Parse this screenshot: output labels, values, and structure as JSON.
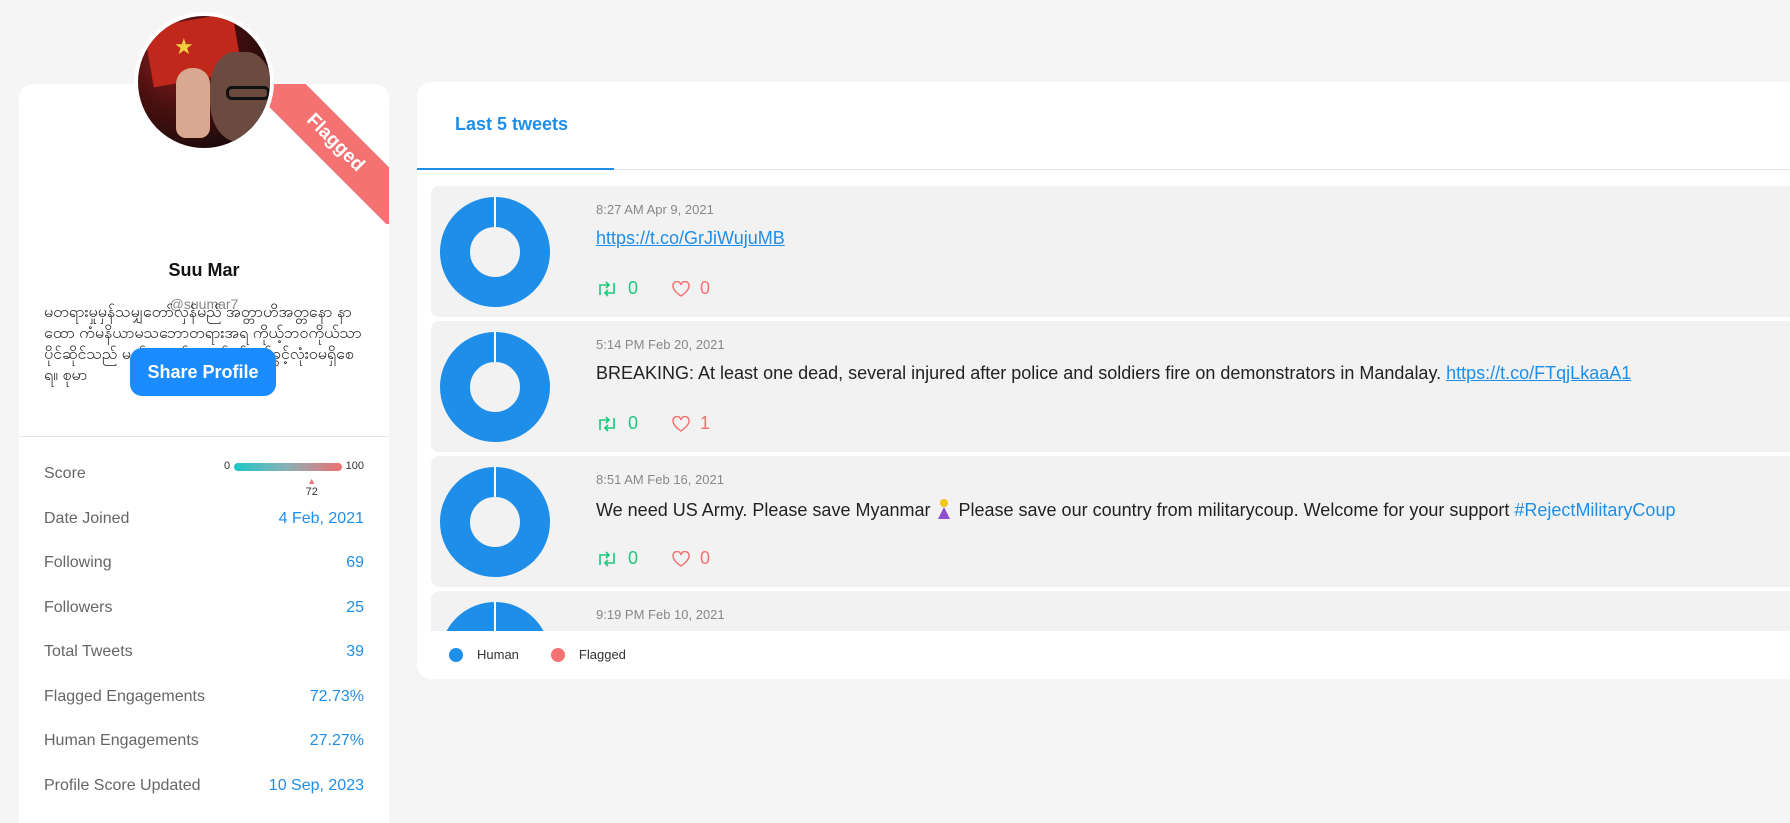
{
  "profile": {
    "name": "Suu Mar",
    "handle": "@suumar7",
    "bio": "မတရားမှုမှန်သမျှတော်လှန်မည် အတ္တာဟိအတ္တနော နာထော ကံမနိယာမသဘောတရားအရ ကိုယ့်ဘဝကိုယ်သာပိုင်ဆိုင်သည် မည်သူမှဝင်ရောက်စွပ်ဖက်ခွင့်လုံးဝမရှိစေရ။ စုမာ",
    "flag_label": "Flagged",
    "share_label": "Share Profile"
  },
  "score": {
    "label": "Score",
    "min": "0",
    "max": "100",
    "value": "72",
    "value_fraction": 0.72
  },
  "stats": [
    {
      "label": "Date Joined",
      "value": "4 Feb, 2021"
    },
    {
      "label": "Following",
      "value": "69"
    },
    {
      "label": "Followers",
      "value": "25"
    },
    {
      "label": "Total Tweets",
      "value": "39"
    },
    {
      "label": "Flagged Engagements",
      "value": "72.73%"
    },
    {
      "label": "Human Engagements",
      "value": "27.27%"
    },
    {
      "label": "Profile Score Updated",
      "value": "10 Sep, 2023"
    }
  ],
  "tweets_panel": {
    "tab_label": "Last 5 tweets",
    "legend": [
      {
        "label": "Human",
        "color": "#1f8ee8"
      },
      {
        "label": "Flagged",
        "color": "#f47272"
      }
    ]
  },
  "tweets": [
    {
      "time": "8:27 AM Apr 9, 2021",
      "text": "",
      "link": "https://t.co/GrJiWujuMB",
      "retweets": "0",
      "likes": "0",
      "human_share": 1.0
    },
    {
      "time": "5:14 PM Feb 20, 2021",
      "text": "BREAKING: At least one dead, several injured after police and soldiers fire on demonstrators in Mandalay.",
      "link": "https://t.co/FTqjLkaaA1",
      "retweets": "0",
      "likes": "1",
      "human_share": 1.0
    },
    {
      "time": "8:51 AM Feb 16, 2021",
      "text_before": "We need US Army. Please save Myanmar",
      "text_after": "Please save our country from militarycoup. Welcome for your support",
      "hashtag": "#RejectMilitaryCoup",
      "retweets": "0",
      "likes": "0",
      "human_share": 1.0
    },
    {
      "time": "9:19 PM Feb 10, 2021",
      "human_share": 1.0
    }
  ],
  "colors": {
    "accent": "#1f8ee8",
    "flagged": "#f47272",
    "retweet": "#1ec77d",
    "button": "#1a8cff"
  }
}
